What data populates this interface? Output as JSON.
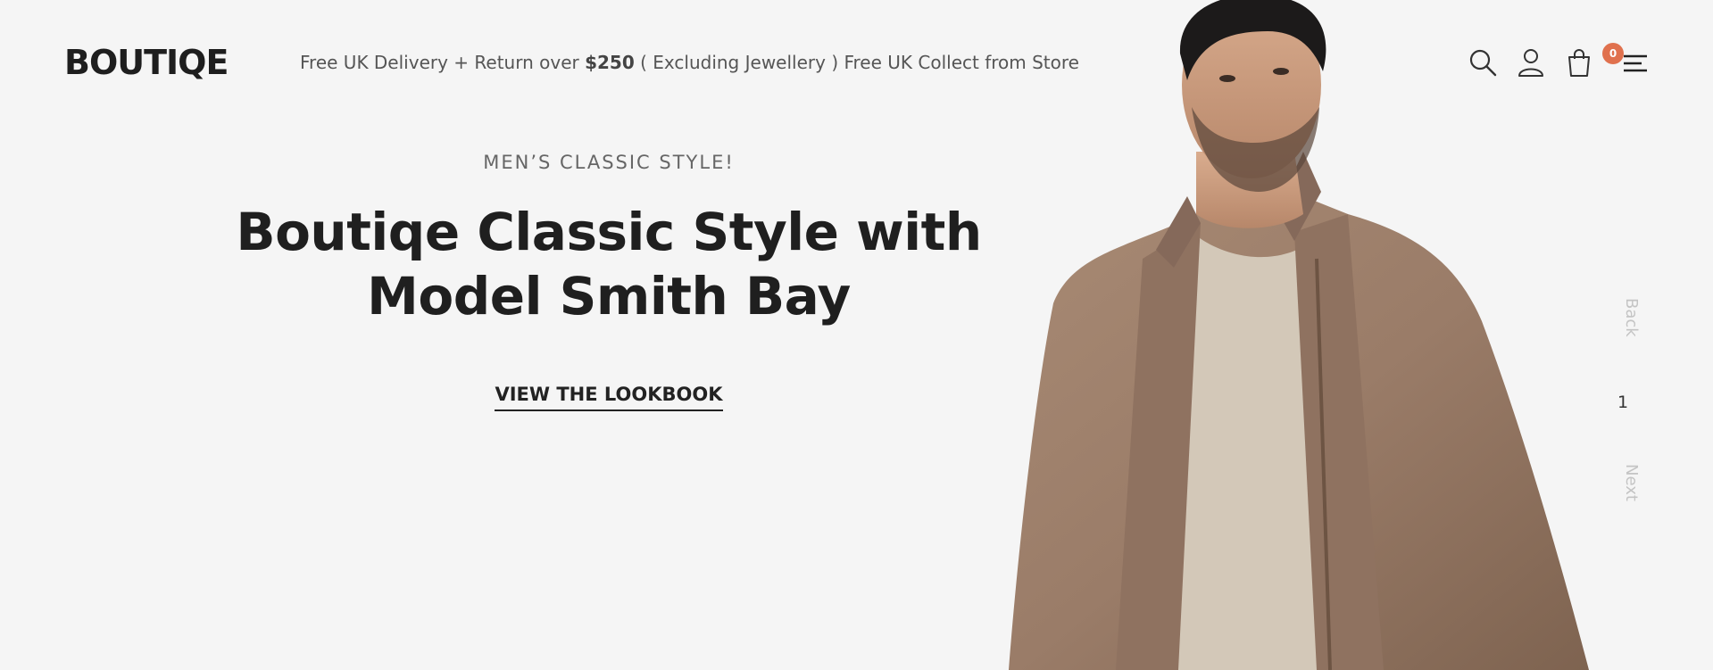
{
  "brand": {
    "logo_text": "BOUTIQE"
  },
  "promo": {
    "text_before": "Free UK Delivery + Return over ",
    "amount": "$250",
    "text_after": " ( Excluding Jewellery ) Free UK Collect from Store"
  },
  "header_icons": {
    "search": "search-icon",
    "account": "user-icon",
    "cart": "shopping-bag-icon",
    "cart_count": "0",
    "menu": "hamburger-menu-icon"
  },
  "hero": {
    "eyebrow": "MEN’S CLASSIC STYLE!",
    "title_line1": "Boutiqe Classic Style with",
    "title_line2": "Model Smith Bay",
    "cta_label": "VIEW THE LOOKBOOK"
  },
  "slider": {
    "back_label": "Back",
    "page": "1",
    "next_label": "Next"
  },
  "colors": {
    "background": "#f5f5f5",
    "badge": "#e0714e",
    "jacket": "#9c7f6a",
    "text_dark": "#1f1f1f"
  }
}
